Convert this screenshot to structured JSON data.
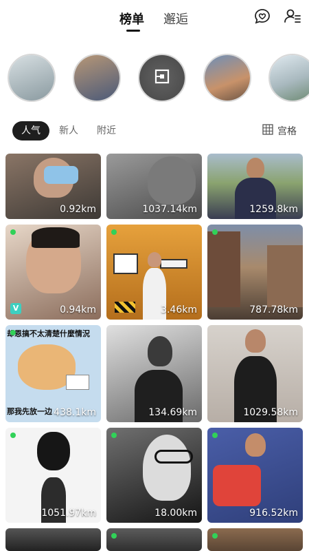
{
  "header": {
    "tabs": [
      {
        "label": "榜单",
        "active": true
      },
      {
        "label": "邂逅",
        "active": false
      }
    ],
    "icons": [
      "heart-chat-icon",
      "user-list-icon"
    ]
  },
  "stories": {
    "items": [
      {
        "palette": [
          "#c9d3d6",
          "#7a8a90"
        ]
      },
      {
        "palette": [
          "#a88a6e",
          "#4b5a78"
        ]
      },
      {
        "palette": [
          "#565656",
          "#3f3f3f"
        ],
        "icon": "brand-logo-icon"
      },
      {
        "palette": [
          "#6e8fb8",
          "#c8926a"
        ]
      },
      {
        "palette": [
          "#d9e6ee",
          "#6d8a72"
        ]
      }
    ]
  },
  "filters": {
    "active": "人气",
    "others": [
      "新人",
      "附近"
    ],
    "grid_label": "宫格",
    "grid_icon": "grid-icon"
  },
  "grid": {
    "tiles": [
      {
        "distance": "0.92km",
        "online": false,
        "vip": false,
        "colors": [
          "#7d6a5d",
          "#3d3935"
        ]
      },
      {
        "distance": "1037.14km",
        "online": false,
        "vip": false,
        "colors": [
          "#8a8a8a",
          "#4a4a4a"
        ]
      },
      {
        "distance": "1259.8km",
        "online": false,
        "vip": false,
        "colors": [
          "#9fb0c2",
          "#3a3d52"
        ]
      },
      {
        "distance": "0.94km",
        "online": true,
        "vip": true,
        "colors": [
          "#d8c4b2",
          "#8b6d5c"
        ]
      },
      {
        "distance": "3.46km",
        "online": true,
        "vip": false,
        "colors": [
          "#e39a36",
          "#b46e1c"
        ]
      },
      {
        "distance": "787.78km",
        "online": true,
        "vip": false,
        "colors": [
          "#7e8ea8",
          "#4b3d33"
        ]
      },
      {
        "distance": "438.1km",
        "online": true,
        "vip": false,
        "colors": [
          "#b7d3e8",
          "#e6b06e"
        ],
        "caption_top": "却恩搞不太清楚什麼情況",
        "caption_bottom": "那我先放一边"
      },
      {
        "distance": "134.69km",
        "online": false,
        "vip": false,
        "colors": [
          "#d6d6d6",
          "#2a2a2a"
        ]
      },
      {
        "distance": "1029.58km",
        "online": false,
        "vip": false,
        "colors": [
          "#d7d2cc",
          "#2a2a2a"
        ]
      },
      {
        "distance": "1051.97km",
        "online": true,
        "vip": false,
        "colors": [
          "#f2f2f2",
          "#5a5a5a"
        ]
      },
      {
        "distance": "18.00km",
        "online": true,
        "vip": false,
        "colors": [
          "#6a6a6a",
          "#1a1a1a"
        ]
      },
      {
        "distance": "916.52km",
        "online": true,
        "vip": false,
        "colors": [
          "#5a6fb5",
          "#d9453a"
        ]
      },
      {
        "distance": "",
        "online": false,
        "vip": false,
        "colors": [
          "#444444",
          "#222222"
        ]
      },
      {
        "distance": "",
        "online": true,
        "vip": false,
        "colors": [
          "#5c5c5c",
          "#2f2f2f"
        ]
      },
      {
        "distance": "",
        "online": true,
        "vip": false,
        "colors": [
          "#8b6b4f",
          "#5a4534"
        ]
      }
    ]
  }
}
